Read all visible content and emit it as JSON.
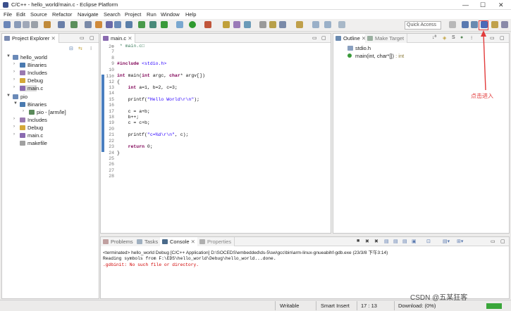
{
  "window": {
    "title": "C/C++ - hello_world/main.c - Eclipse Platform"
  },
  "menu": [
    "File",
    "Edit",
    "Source",
    "Refactor",
    "Navigate",
    "Search",
    "Project",
    "Run",
    "Window",
    "Help"
  ],
  "toolbar": {
    "quick_access_placeholder": "Quick Access"
  },
  "project_explorer": {
    "tab_label": "Project Explorer",
    "items": [
      {
        "label": "hello_world",
        "level": 0
      },
      {
        "label": "Binaries",
        "level": 1
      },
      {
        "label": "Includes",
        "level": 1
      },
      {
        "label": "Debug",
        "level": 1
      },
      {
        "label": "main.c",
        "level": 1
      },
      {
        "label": "pio",
        "level": 0
      },
      {
        "label": "Binaries",
        "level": 1
      },
      {
        "label": "pio - [arm/le]",
        "level": 2
      },
      {
        "label": "Includes",
        "level": 1
      },
      {
        "label": "Debug",
        "level": 1
      },
      {
        "label": "main.c",
        "level": 1
      },
      {
        "label": "makefile",
        "level": 1
      }
    ]
  },
  "editor": {
    "tab_label": "main.c",
    "lines": [
      {
        "n": "2⊕",
        "text": " * main.c□"
      },
      {
        "n": "7",
        "text": ""
      },
      {
        "n": "8",
        "text": ""
      },
      {
        "n": "9",
        "text": "#include <stdio.h>"
      },
      {
        "n": "10",
        "text": ""
      },
      {
        "n": "11⊖",
        "text": "int main(int argc, char* argv[])"
      },
      {
        "n": "12",
        "text": "{"
      },
      {
        "n": "13",
        "text": "    int a=1, b=2, c=3;"
      },
      {
        "n": "14",
        "text": ""
      },
      {
        "n": "15",
        "text": "    printf(\"Hello World\\r\\n\");"
      },
      {
        "n": "16",
        "text": ""
      },
      {
        "n": "17",
        "text": "    c = a+b;"
      },
      {
        "n": "18",
        "text": "    b++;"
      },
      {
        "n": "19",
        "text": "    c = c+b;"
      },
      {
        "n": "20",
        "text": ""
      },
      {
        "n": "21",
        "text": "    printf(\"c=%d\\r\\n\", c);"
      },
      {
        "n": "22",
        "text": ""
      },
      {
        "n": "23",
        "text": "    return 0;"
      },
      {
        "n": "24",
        "text": "}"
      },
      {
        "n": "25",
        "text": ""
      },
      {
        "n": "26",
        "text": ""
      },
      {
        "n": "27",
        "text": ""
      },
      {
        "n": "28",
        "text": ""
      }
    ]
  },
  "outline": {
    "tab_label": "Outline",
    "tab2_label": "Make Target",
    "items": [
      {
        "label": "stdio.h",
        "suffix": ""
      },
      {
        "label": "main(int, char*[])",
        "suffix": " : int"
      }
    ]
  },
  "annotation": {
    "text": "点击进入"
  },
  "console": {
    "tabs": [
      "Problems",
      "Tasks",
      "Console",
      "Properties"
    ],
    "header": "<terminated> hello_world Debug [C/C++ Application] D:\\SOCEDS\\embedded\\ds-5\\sw\\gcc\\bin\\arm-linux-gnueabihf-gdb.exe (23/3/8 下午3:14)",
    "lines": [
      {
        "text": "Reading symbols from F:\\EDS\\hello_world\\Debug\\hello_world...done.",
        "color": "#111111"
      },
      {
        "text": ".gdbinit: No such file or directory.",
        "color": "#d00000"
      }
    ]
  },
  "status": {
    "writable": "Writable",
    "insert": "Smart Insert",
    "position": "17 : 13",
    "download": "Download: (0%)"
  },
  "watermark": {
    "text": "CSDN @五某狂客"
  },
  "colors": {
    "accent_red": "#e23b3b",
    "console_error": "#d00000"
  }
}
